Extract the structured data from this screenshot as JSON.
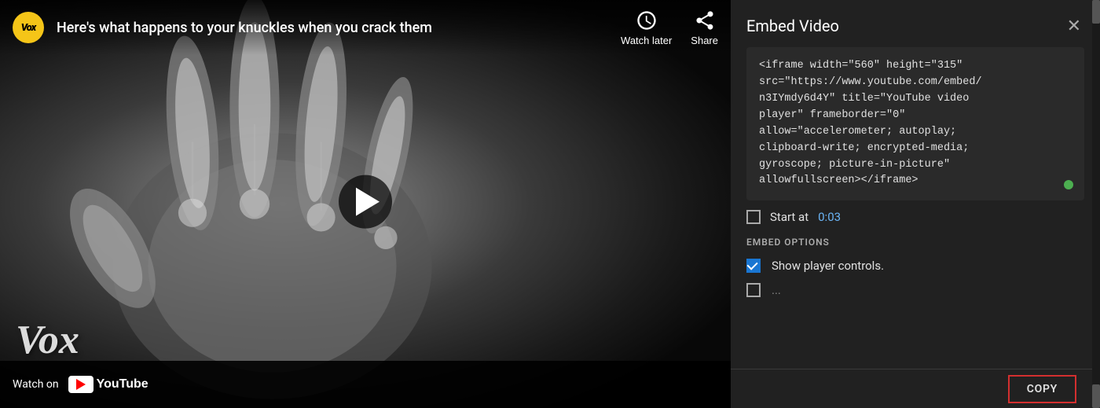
{
  "video": {
    "logo_text": "Vox",
    "title": "Here's what happens to your knuckles when you crack them",
    "watch_later_label": "Watch later",
    "share_label": "Share",
    "watch_on_label": "Watch on",
    "youtube_label": "YouTube",
    "vox_watermark": "Vox"
  },
  "embed": {
    "title": "Embed Video",
    "close_label": "✕",
    "code": "<iframe width=\"560\" height=\"315\"\nsrc=\"https://www.youtube.com/embed/\nn3IYmdy6d4Y\" title=\"YouTube video\nplayer\" frameborder=\"0\"\nallow=\"accelerometer; autoplay;\nclipboard-write; encrypted-media;\ngyroscope; picture-in-picture\"\nallowfullscreen></iframe>",
    "start_at_label": "Start at",
    "start_at_time": "0:03",
    "embed_options_label": "EMBED OPTIONS",
    "show_controls_label": "Show player controls.",
    "copy_label": "COPY"
  },
  "colors": {
    "accent_blue": "#6ab4f5",
    "checkbox_blue": "#1976d2",
    "copy_border": "#d32f2f",
    "green_dot": "#4caf50"
  }
}
